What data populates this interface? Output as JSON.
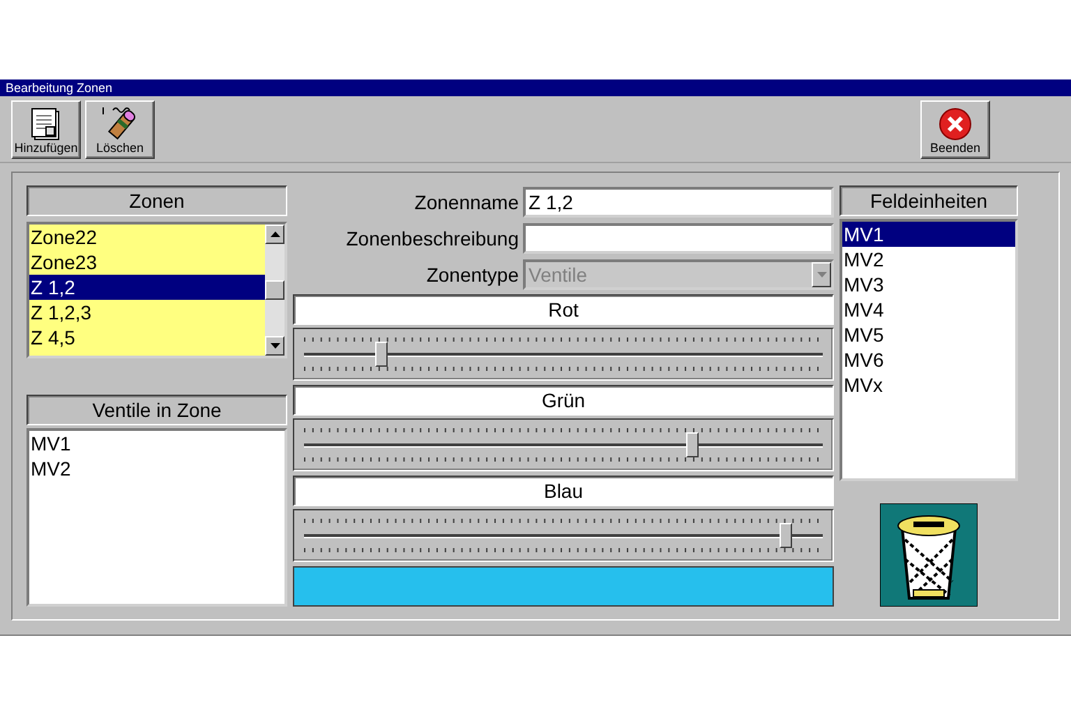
{
  "window": {
    "title": "Bearbeitung Zonen"
  },
  "toolbar": [
    {
      "kind": "add",
      "label": "Hinzufügen"
    },
    {
      "kind": "delete",
      "label": "Löschen"
    }
  ],
  "exit_button": {
    "label": "Beenden"
  },
  "zones": {
    "header": "Zonen",
    "items": [
      {
        "label": "Zone22",
        "selected": false
      },
      {
        "label": "Zone23",
        "selected": false
      },
      {
        "label": "Z 1,2",
        "selected": true
      },
      {
        "label": "Z 1,2,3",
        "selected": false
      },
      {
        "label": "Z 4,5",
        "selected": false
      }
    ]
  },
  "valves_in_zone": {
    "header": "Ventile in Zone",
    "items": [
      "MV1",
      "MV2"
    ]
  },
  "form": [
    {
      "kind": "text",
      "label": "Zonenname",
      "value": "Z 1,2"
    },
    {
      "kind": "text",
      "label": "Zonenbeschreibung"
    },
    {
      "kind": "select",
      "label": "Zonentype",
      "value": "Ventile",
      "disabled": true
    }
  ],
  "sliders": [
    {
      "label": "Rot",
      "level": 0.15
    },
    {
      "label": "Grün",
      "level": 0.75
    },
    {
      "label": "Blau",
      "level": 0.93
    }
  ],
  "field_units": {
    "header": "Feldeinheiten",
    "items": [
      {
        "label": "MV1",
        "selected": true
      },
      {
        "label": "MV2",
        "selected": false
      },
      {
        "label": "MV3",
        "selected": false
      },
      {
        "label": "MV4",
        "selected": false
      },
      {
        "label": "MV5",
        "selected": false
      },
      {
        "label": "MV6",
        "selected": false
      },
      {
        "label": "MVx",
        "selected": false
      }
    ]
  }
}
